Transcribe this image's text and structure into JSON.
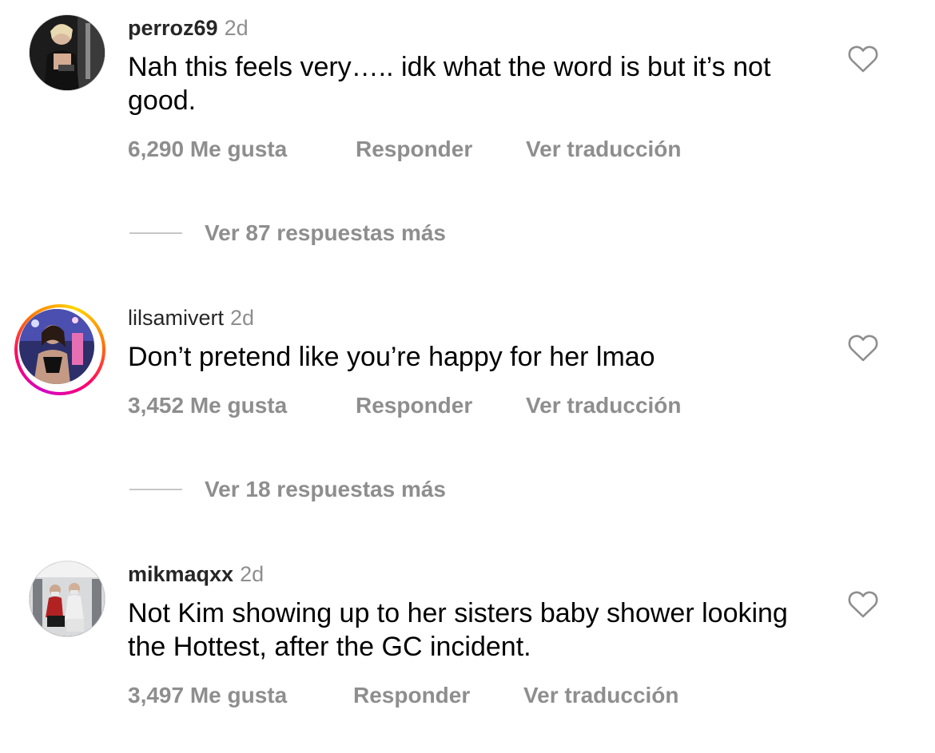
{
  "comments": [
    {
      "username": "perroz69",
      "time": "2d",
      "text": "Nah this feels very….. idk what the word is but it’s not good.",
      "likes": "6,290 Me gusta",
      "reply": "Responder",
      "translate": "Ver traducción",
      "replies": "Ver 87 respuestas más"
    },
    {
      "username": "lilsamivert",
      "time": "2d",
      "text": "Don’t pretend like you’re happy for her lmao",
      "likes": "3,452 Me gusta",
      "reply": "Responder",
      "translate": "Ver traducción",
      "replies": "Ver 18 respuestas más"
    },
    {
      "username": "mikmaqxx",
      "time": "2d",
      "text": "Not Kim showing up to her sisters baby shower looking the Hottest, after the GC incident.",
      "likes": "3,497 Me gusta",
      "reply": "Responder",
      "translate": "Ver traducción"
    }
  ],
  "icons": {
    "like": "heart-outline-icon",
    "story_ring": "instagram-story-gradient"
  },
  "colors": {
    "text": "#000000",
    "username": "#262626",
    "secondary": "#8e8e8e",
    "divider": "#c7c7c7"
  }
}
